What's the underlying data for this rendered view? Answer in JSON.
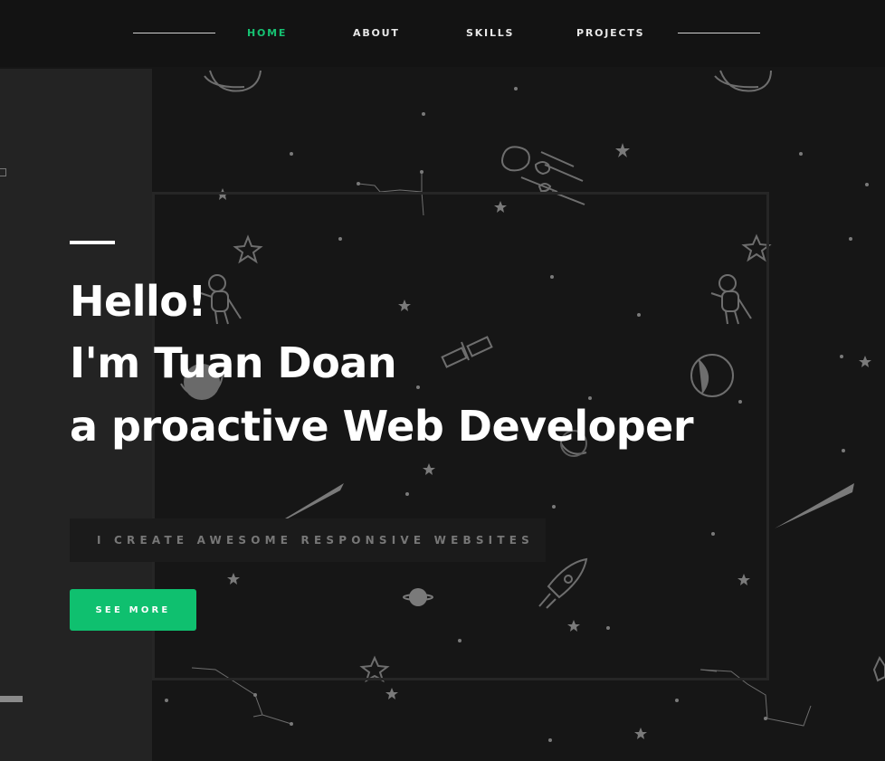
{
  "nav": {
    "items": [
      {
        "label": "HOME",
        "active": true
      },
      {
        "label": "ABOUT",
        "active": false
      },
      {
        "label": "SKILLS",
        "active": false
      },
      {
        "label": "PROJECTS",
        "active": false
      }
    ]
  },
  "hero": {
    "greeting": "Hello!",
    "name_line": "I'm Tuan Doan",
    "role_line": "a proactive Web Developer",
    "tagline": "I CREATE AWESOME RESPONSIVE WEBSITES",
    "cta_label": "SEE MORE"
  },
  "colors": {
    "accent": "#16c172",
    "button": "#0fc06f",
    "background": "#161616",
    "panel": "#232323"
  },
  "icons": [
    "planet-icon",
    "astronaut-icon",
    "satellite-icon",
    "rocket-icon",
    "comet-icon",
    "asteroid-icon",
    "star-icon",
    "constellation-icon",
    "moon-icon"
  ]
}
